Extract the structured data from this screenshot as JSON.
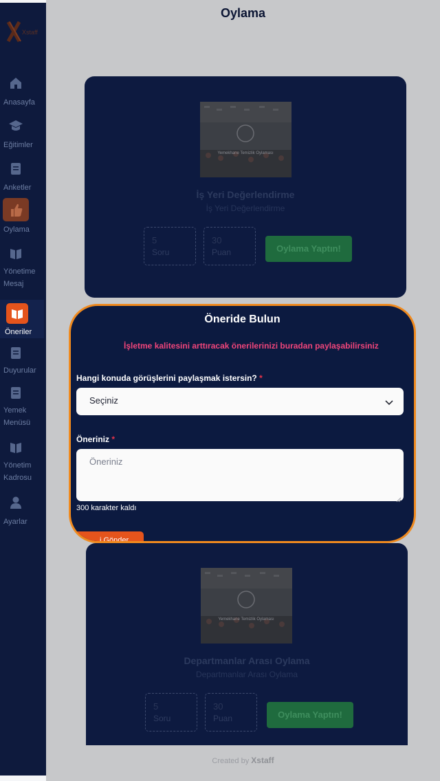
{
  "page": {
    "title": "Oylama"
  },
  "brand": {
    "logo_text": "Xstaff",
    "accent": "#e5541c",
    "modal_border": "#f08a1e"
  },
  "sidebar": {
    "items": [
      {
        "label": "Anasayfa",
        "icon": "home-icon"
      },
      {
        "label": "Eğitimler",
        "icon": "graduation-cap-icon"
      },
      {
        "label": "Anketler",
        "icon": "clipboard-icon"
      },
      {
        "label": "Oylama",
        "icon": "thumbs-up-icon"
      },
      {
        "label": "Yönetime Mesaj",
        "icon": "book-icon"
      },
      {
        "label": "Öneriler",
        "icon": "book-open-icon"
      },
      {
        "label": "Duyurular",
        "icon": "clipboard-icon"
      },
      {
        "label": "Yemek Menüsü",
        "icon": "clipboard-icon"
      },
      {
        "label": "Yönetim Kadrosu",
        "icon": "book-icon"
      },
      {
        "label": "Ayarlar",
        "icon": "user-icon"
      }
    ]
  },
  "cards": [
    {
      "image_caption": "Yemekhane Temizlik Oylaması",
      "title": "İş Yeri Değerlendirme",
      "subtitle": "İş Yeri Değerlendirme",
      "stats": [
        {
          "num": "5",
          "unit": "Soru"
        },
        {
          "num": "30",
          "unit": "Puan"
        }
      ],
      "button": "Oylama Yaptın!"
    },
    {
      "image_caption": "Yemekhane Temizlik Oylaması",
      "title": "Departmanlar Arası Oylama",
      "subtitle": "Departmanlar Arası Oylama",
      "stats": [
        {
          "num": "5",
          "unit": "Soru"
        },
        {
          "num": "30",
          "unit": "Puan"
        }
      ],
      "button": "Oylama Yaptın!"
    }
  ],
  "modal": {
    "title": "Öneride Bulun",
    "description": "İşletme kalitesini arttıracak önerilerinizi buradan paylaşabilirsiniz",
    "topic_label": "Hangi konuda görüşlerini paylaşmak istersin?",
    "topic_value": "Seçiniz",
    "suggestion_label": "Öneriniz",
    "suggestion_placeholder": "Öneriniz",
    "required_mark": "*",
    "counter": "300 karakter kaldı",
    "send_button": "i Gönder"
  },
  "footer": {
    "created_by": "Created by",
    "brand": "Xstaff"
  }
}
